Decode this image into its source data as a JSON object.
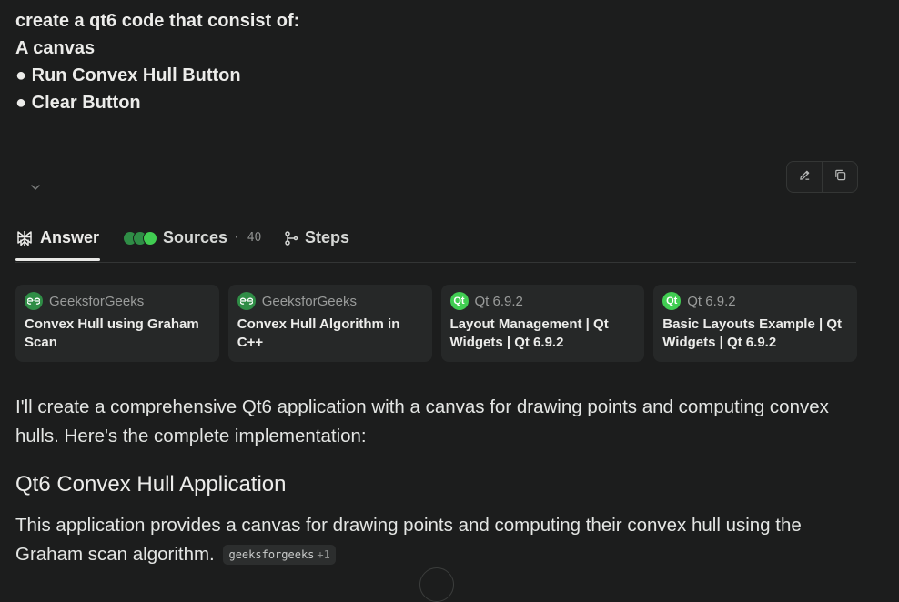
{
  "query": {
    "lines": [
      "create a qt6 code that consist of:",
      "A canvas",
      "● Run Convex Hull Button",
      "● Clear Button"
    ]
  },
  "tabs": {
    "answer": "Answer",
    "sources": "Sources",
    "sources_count": "· 40",
    "steps": "Steps"
  },
  "sources": [
    {
      "site": "GeeksforGeeks",
      "icon": "gfg-logo",
      "title": "Convex Hull using Graham Scan"
    },
    {
      "site": "GeeksforGeeks",
      "icon": "gfg-logo",
      "title": "Convex Hull Algorithm in C++"
    },
    {
      "site": "Qt 6.9.2",
      "icon": "qt-logo",
      "title": "Layout Management | Qt Widgets | Qt 6.9.2"
    },
    {
      "site": "Qt 6.9.2",
      "icon": "qt-logo",
      "title": "Basic Layouts Example | Qt Widgets | Qt 6.9.2"
    }
  ],
  "answer": {
    "intro": "I'll create a comprehensive Qt6 application with a canvas for drawing points and computing convex hulls. Here's the complete implementation:",
    "heading": "Qt6 Convex Hull Application",
    "paragraph": "This application provides a canvas for drawing points and computing their convex hull using the Graham scan algorithm.",
    "citation": "geeksforgeeks",
    "citation_more": "+1"
  },
  "colors": {
    "background": "#1c1d1d",
    "card": "#262828",
    "gfg_green": "#2f8d46",
    "qt_green": "#41cd52"
  }
}
